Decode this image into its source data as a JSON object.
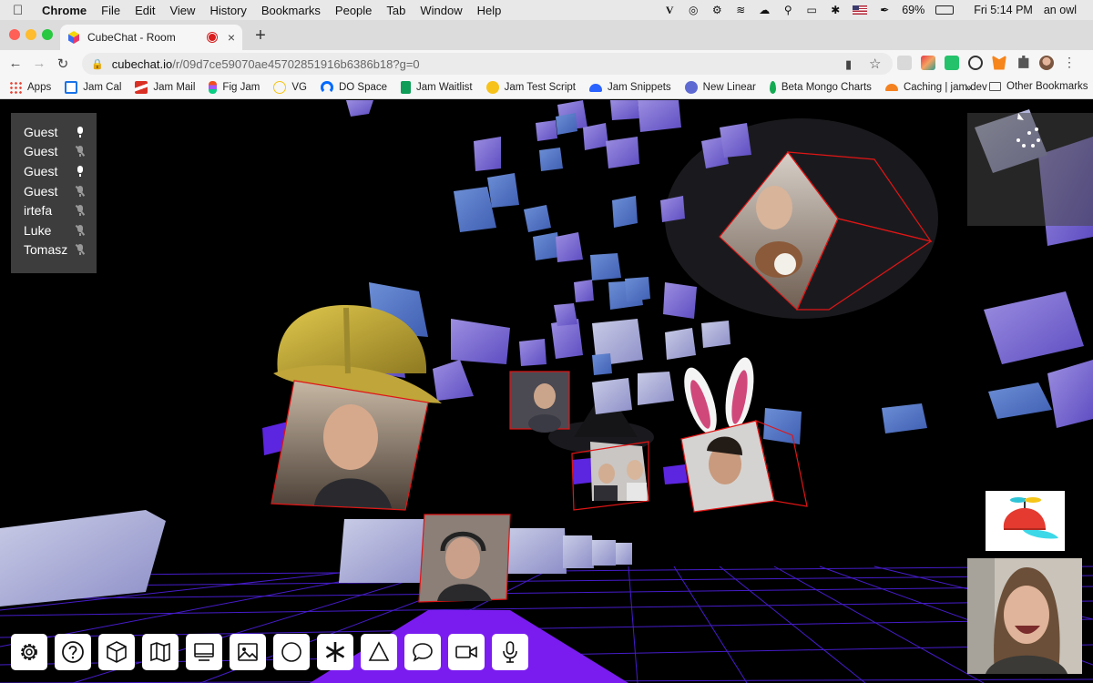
{
  "menubar": {
    "app": "Chrome",
    "items": [
      "File",
      "Edit",
      "View",
      "History",
      "Bookmarks",
      "People",
      "Tab",
      "Window",
      "Help"
    ],
    "battery": "69%",
    "clock": "Fri 5:14 PM",
    "user": "an owl",
    "status_icons": [
      "vimeo-icon",
      "target-icon",
      "sun-icon",
      "stream-icon",
      "cloud-icon",
      "search-icon",
      "airplay-icon",
      "bluetooth-icon",
      "us-flag-icon",
      "wifi-icon",
      "battery-icon"
    ]
  },
  "tab": {
    "title": "CubeChat - Room",
    "new_tab": "+",
    "close": "×"
  },
  "address": {
    "host": "cubechat.io",
    "path": "/r/09d7ce59070ae45702851916b6386b18?g=0"
  },
  "bookmarks": {
    "items": [
      {
        "label": "Apps",
        "icon": "apps-grid-icon",
        "color": "#4285f4"
      },
      {
        "label": "Jam Cal",
        "icon": "calendar-icon",
        "color": "#1a73e8"
      },
      {
        "label": "Jam Mail",
        "icon": "gmail-icon",
        "color": "#d93025"
      },
      {
        "label": "Fig Jam",
        "icon": "figma-icon",
        "color": "#f24e1e"
      },
      {
        "label": "VG",
        "icon": "vg-icon",
        "color": "#f5c518"
      },
      {
        "label": "DO Space",
        "icon": "digitalocean-icon",
        "color": "#0069ff"
      },
      {
        "label": "Jam Waitlist",
        "icon": "sheets-icon",
        "color": "#0f9d58"
      },
      {
        "label": "Jam Test Script",
        "icon": "sunglasses-emoji-icon",
        "color": "#f7c21a"
      },
      {
        "label": "Jam Snippets",
        "icon": "cap-icon",
        "color": "#2962ff"
      },
      {
        "label": "New Linear",
        "icon": "linear-icon",
        "color": "#5e6ad2"
      },
      {
        "label": "Beta Mongo Charts",
        "icon": "mongo-leaf-icon",
        "color": "#13aa52"
      },
      {
        "label": "Caching | jam.dev",
        "icon": "cloudflare-icon",
        "color": "#f48120"
      }
    ],
    "more": "»",
    "other": "Other Bookmarks"
  },
  "participants": [
    {
      "name": "Guest",
      "muted": false
    },
    {
      "name": "Guest",
      "muted": true
    },
    {
      "name": "Guest",
      "muted": false
    },
    {
      "name": "Guest",
      "muted": true
    },
    {
      "name": "irtefa",
      "muted": true
    },
    {
      "name": "Luke",
      "muted": true
    },
    {
      "name": "Tomasz",
      "muted": true
    }
  ],
  "tools": [
    {
      "name": "settings-button",
      "icon": "gear-icon"
    },
    {
      "name": "help-button",
      "icon": "question-icon"
    },
    {
      "name": "cube-button",
      "icon": "cube-icon"
    },
    {
      "name": "map-button",
      "icon": "map-icon"
    },
    {
      "name": "screen-share-button",
      "icon": "monitor-icon"
    },
    {
      "name": "image-button",
      "icon": "image-icon"
    },
    {
      "name": "circle-button",
      "icon": "circle-icon"
    },
    {
      "name": "asterisk-button",
      "icon": "asterisk-icon"
    },
    {
      "name": "triangle-button",
      "icon": "triangle-icon"
    },
    {
      "name": "chat-button",
      "icon": "speech-bubble-icon"
    },
    {
      "name": "camera-button",
      "icon": "video-camera-icon"
    },
    {
      "name": "mic-button",
      "icon": "microphone-icon"
    }
  ],
  "colors": {
    "grid": "#5a24f0",
    "floor_accent": "#7a1cf0",
    "cube_face": "#b7bfe0",
    "cube_violet": "#7f74d4",
    "video_outline": "#e01515",
    "panel_bg": "#3d3d3d",
    "hardhat": "#c7ad3c"
  }
}
